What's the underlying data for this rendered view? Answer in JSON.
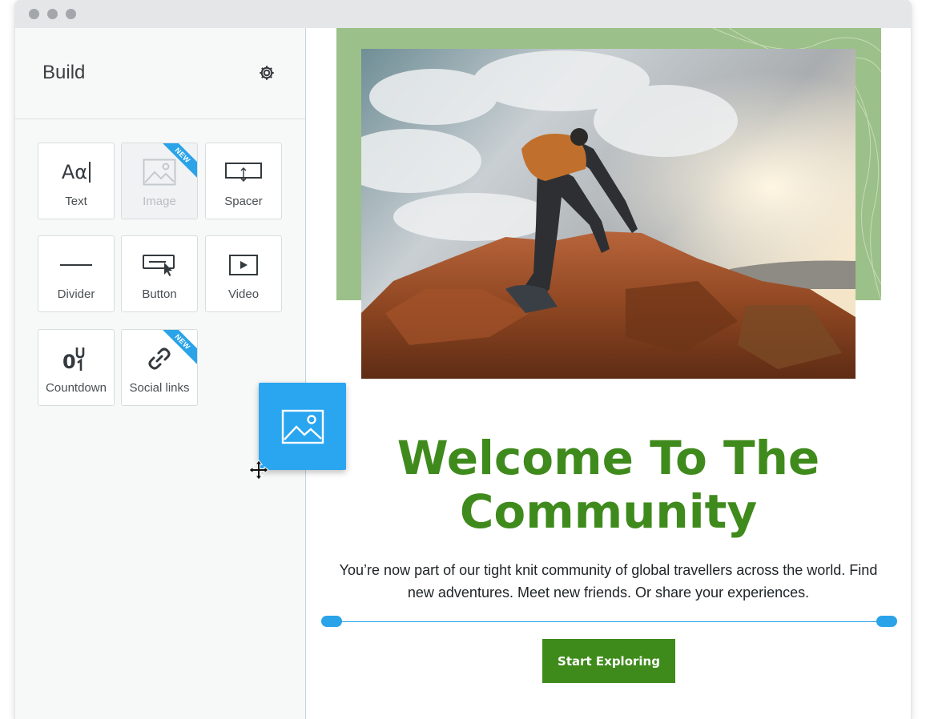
{
  "window": {
    "controls": [
      "close",
      "minimize",
      "zoom"
    ]
  },
  "sidebar": {
    "title": "Build",
    "settings_icon": "gear-icon",
    "tiles": [
      {
        "label": "Text",
        "icon": "text-icon",
        "glyph": "Aα",
        "is_new": false,
        "disabled": false
      },
      {
        "label": "Image",
        "icon": "image-icon",
        "is_new": true,
        "disabled": true,
        "badge": "NEW"
      },
      {
        "label": "Spacer",
        "icon": "spacer-icon",
        "is_new": false,
        "disabled": false
      },
      {
        "label": "Divider",
        "icon": "divider-icon",
        "is_new": false,
        "disabled": false
      },
      {
        "label": "Button",
        "icon": "button-icon",
        "is_new": false,
        "disabled": false
      },
      {
        "label": "Video",
        "icon": "video-icon",
        "is_new": false,
        "disabled": false
      },
      {
        "label": "Countdown",
        "icon": "countdown-icon",
        "is_new": false,
        "disabled": false
      },
      {
        "label": "Social links",
        "icon": "link-icon",
        "is_new": true,
        "disabled": false,
        "badge": "NEW"
      }
    ]
  },
  "canvas": {
    "headline": "Welcome To The Community",
    "body": "You’re now part of our tight knit community of global travellers across the world. Find new adventures. Meet new friends. Or share your experiences.",
    "cta_label": "Start Exploring",
    "hero_image": "hiker-on-rocks-image"
  },
  "drag": {
    "icon": "image-icon",
    "cursor": "move-cursor-icon"
  },
  "colors": {
    "accent_blue": "#2aa5f0",
    "brand_green": "#3e8a1b",
    "band_green": "#9cc089",
    "sidebar_bg": "#f7f8f8"
  }
}
